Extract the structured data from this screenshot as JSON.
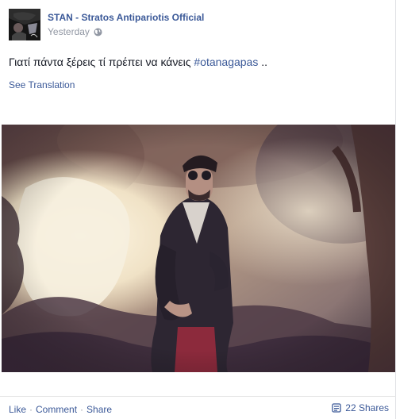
{
  "post": {
    "author": "STAN - Stratos Antipariotis Official",
    "timestamp": "Yesterday",
    "privacy_icon": "globe-icon",
    "text_main": "Γιατί πάντα ξέρεις τί πρέπει να κάνεις ",
    "hashtag": "#otanagapas",
    "text_tail": " ..",
    "translate_link": "See Translation",
    "photo_description": "man in sunglasses and dark blazer standing outdoors among trees"
  },
  "actions": {
    "like": "Like",
    "comment": "Comment",
    "share": "Share",
    "separator": "·"
  },
  "shares": {
    "icon": "share-icon",
    "count": "22 Shares"
  },
  "colors": {
    "link": "#3b5998",
    "text": "#141823",
    "meta": "#9197a3"
  }
}
